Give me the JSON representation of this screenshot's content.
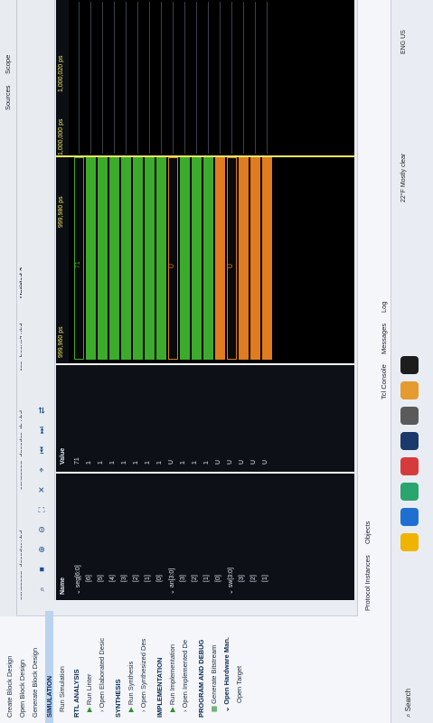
{
  "flow": {
    "items": [
      "Create Block Design",
      "Open Block Design",
      "Generate Block Design",
      "SIMULATION",
      "Run Simulation",
      "RTL ANALYSIS",
      "Run Linter",
      "Open Elaborated Desic",
      "SYNTHESIS",
      "Run Synthesis",
      "Open Synthesized Des",
      "IMPLEMENTATION",
      "Run Implementation",
      "Open Implemented De",
      "PROGRAM AND DEBUG",
      "Generate Bitstream",
      "Open Hardware Man.",
      "Open Target"
    ]
  },
  "panels": {
    "sources": "Sources",
    "scope": "Scope",
    "protocol_instances": "Protocol Instances",
    "objects": "Objects",
    "tcl_console": "Tcl Console",
    "messages": "Messages",
    "log": "Log"
  },
  "editor": {
    "tabs": [
      "sevenseg_decoder.vhd",
      "sevenseg_decoder_tb.vhd",
      "top_basys3.vhd",
      "Untitled 2"
    ]
  },
  "wave": {
    "header_name": "Name",
    "header_value": "Value",
    "time_labels": [
      "999,960 ps",
      "999,980 ps",
      "1,000,020 ps"
    ],
    "cursor_time": "1,000,000 ps",
    "signals": [
      {
        "name": "seg[6:0]",
        "value": "71",
        "kind": "bus",
        "color": "#3cab2b",
        "bus_text": "71"
      },
      {
        "name": "[6]",
        "value": "1",
        "kind": "bit",
        "color": "#3cab2b"
      },
      {
        "name": "[5]",
        "value": "1",
        "kind": "bit",
        "color": "#3cab2b"
      },
      {
        "name": "[4]",
        "value": "1",
        "kind": "bit",
        "color": "#3cab2b"
      },
      {
        "name": "[3]",
        "value": "1",
        "kind": "bit",
        "color": "#3cab2b"
      },
      {
        "name": "[2]",
        "value": "1",
        "kind": "bit",
        "color": "#3cab2b"
      },
      {
        "name": "[1]",
        "value": "1",
        "kind": "bit",
        "color": "#3cab2b"
      },
      {
        "name": "[0]",
        "value": "1",
        "kind": "bit",
        "color": "#3cab2b"
      },
      {
        "name": "an[3:0]",
        "value": "U",
        "kind": "bus",
        "color": "#e07b1f",
        "bus_text": "U"
      },
      {
        "name": "[3]",
        "value": "1",
        "kind": "bit",
        "color": "#3cab2b"
      },
      {
        "name": "[2]",
        "value": "1",
        "kind": "bit",
        "color": "#3cab2b"
      },
      {
        "name": "[1]",
        "value": "1",
        "kind": "bit",
        "color": "#3cab2b"
      },
      {
        "name": "[0]",
        "value": "U",
        "kind": "bit",
        "color": "#e07b1f"
      },
      {
        "name": "sw[3:0]",
        "value": "U",
        "kind": "bus",
        "color": "#e07b1f",
        "bus_text": "U"
      },
      {
        "name": "[3]",
        "value": "U",
        "kind": "bit",
        "color": "#e07b1f"
      },
      {
        "name": "[2]",
        "value": "U",
        "kind": "bit",
        "color": "#e07b1f"
      },
      {
        "name": "[1]",
        "value": "U",
        "kind": "bit",
        "color": "#e07b1f"
      }
    ]
  },
  "taskbar": {
    "search": "Search",
    "weather_temp": "22°F",
    "weather_text": "Mostly clear",
    "lang": "ENG",
    "region": "US"
  }
}
